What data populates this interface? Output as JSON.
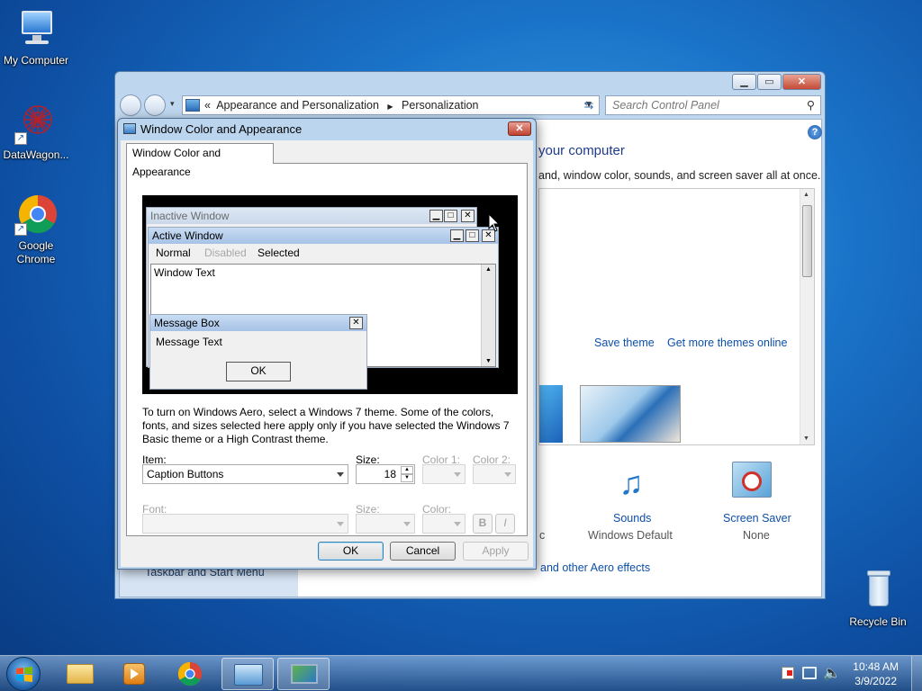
{
  "desktop": {
    "icons": [
      {
        "label": "My Computer"
      },
      {
        "label": "DataWagon..."
      },
      {
        "label": "Google Chrome"
      },
      {
        "label": "Recycle Bin"
      }
    ]
  },
  "control_panel": {
    "breadcrumb": [
      "Appearance and Personalization",
      "Personalization"
    ],
    "breadcrumb_prefix": "«",
    "search_placeholder": "Search Control Panel",
    "heading_partial": "your computer",
    "subheading_partial": "and, window color, sounds, and screen saver all at once.",
    "save_theme": "Save theme",
    "get_more_themes": "Get more themes online",
    "sounds_label": "Sounds",
    "sounds_value": "Windows Default",
    "screensaver_label": "Screen Saver",
    "screensaver_value": "None",
    "partial_c": "c",
    "taskbar_link": "Taskbar and Start Menu",
    "aero_link": "and other Aero effects"
  },
  "dialog": {
    "title": "Window Color and Appearance",
    "tab": "Window Color and Appearance",
    "preview": {
      "inactive_title": "Inactive Window",
      "active_title": "Active Window",
      "menu_normal": "Normal",
      "menu_disabled": "Disabled",
      "menu_selected": "Selected",
      "window_text": "Window Text",
      "msgbox_title": "Message Box",
      "msgbox_text": "Message Text",
      "ok": "OK"
    },
    "info_text": "To turn on Windows Aero, select a Windows 7 theme.  Some of the colors, fonts, and sizes selected here apply only if you have selected the Windows 7 Basic theme or a High Contrast theme.",
    "item_label": "Item:",
    "item_value": "Caption Buttons",
    "size_label": "Size:",
    "size_value": "18",
    "color1_label": "Color 1:",
    "color2_label": "Color 2:",
    "font_label": "Font:",
    "font_size_label": "Size:",
    "font_color_label": "Color:",
    "bold": "B",
    "italic": "I",
    "ok": "OK",
    "cancel": "Cancel",
    "apply": "Apply"
  },
  "taskbar": {
    "time": "10:48 AM",
    "date": "3/9/2022"
  }
}
